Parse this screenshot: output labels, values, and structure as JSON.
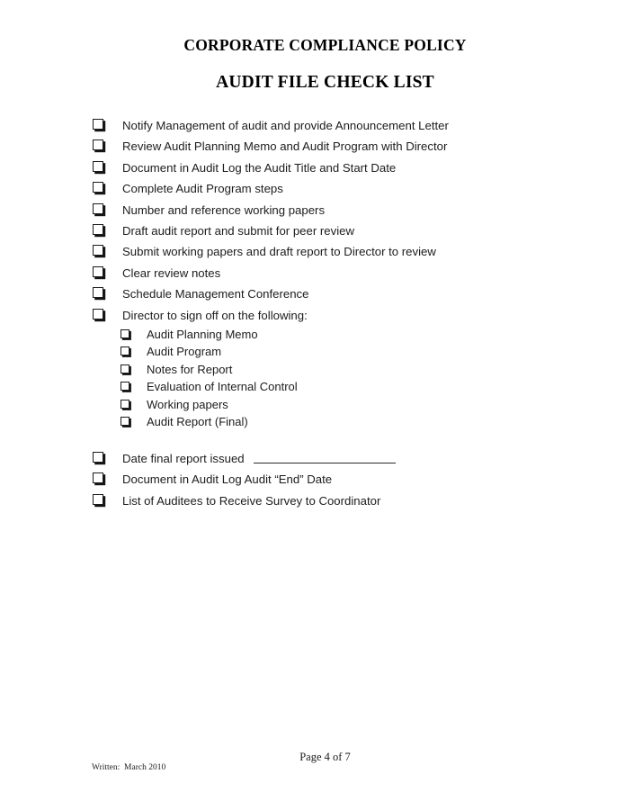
{
  "document": {
    "title_line_1": "CORPORATE COMPLIANCE POLICY",
    "title_line_2": "AUDIT FILE CHECK LIST"
  },
  "checklist": {
    "main_items": [
      {
        "label": "Notify Management of audit and provide Announcement Letter"
      },
      {
        "label": "Review Audit Planning Memo and Audit Program with Director"
      },
      {
        "label": "Document in Audit Log the Audit Title and Start Date"
      },
      {
        "label": "Complete Audit Program steps"
      },
      {
        "label": "Number and reference working papers"
      },
      {
        "label": "Draft audit report and submit for peer review"
      },
      {
        "label": "Submit working papers and draft report to Director to review"
      },
      {
        "label": "Clear review notes"
      },
      {
        "label": "Schedule Management Conference"
      },
      {
        "label": "Director to sign off on the following:"
      }
    ],
    "sub_items": [
      {
        "label": "Audit Planning Memo"
      },
      {
        "label": "Audit Program"
      },
      {
        "label": "Notes for Report"
      },
      {
        "label": "Evaluation of Internal Control"
      },
      {
        "label": "Working papers"
      },
      {
        "label": "Audit Report (Final)"
      }
    ],
    "closing_items": [
      {
        "label": "Date final report issued",
        "has_blank_rule": true
      },
      {
        "label": "Document in Audit Log Audit “End” Date",
        "has_blank_rule": false
      },
      {
        "label": "List of Auditees to Receive Survey to Coordinator",
        "has_blank_rule": false
      }
    ]
  },
  "footer": {
    "page_number": "Page 4 of 7",
    "written_note": "Written:  March 2010"
  }
}
